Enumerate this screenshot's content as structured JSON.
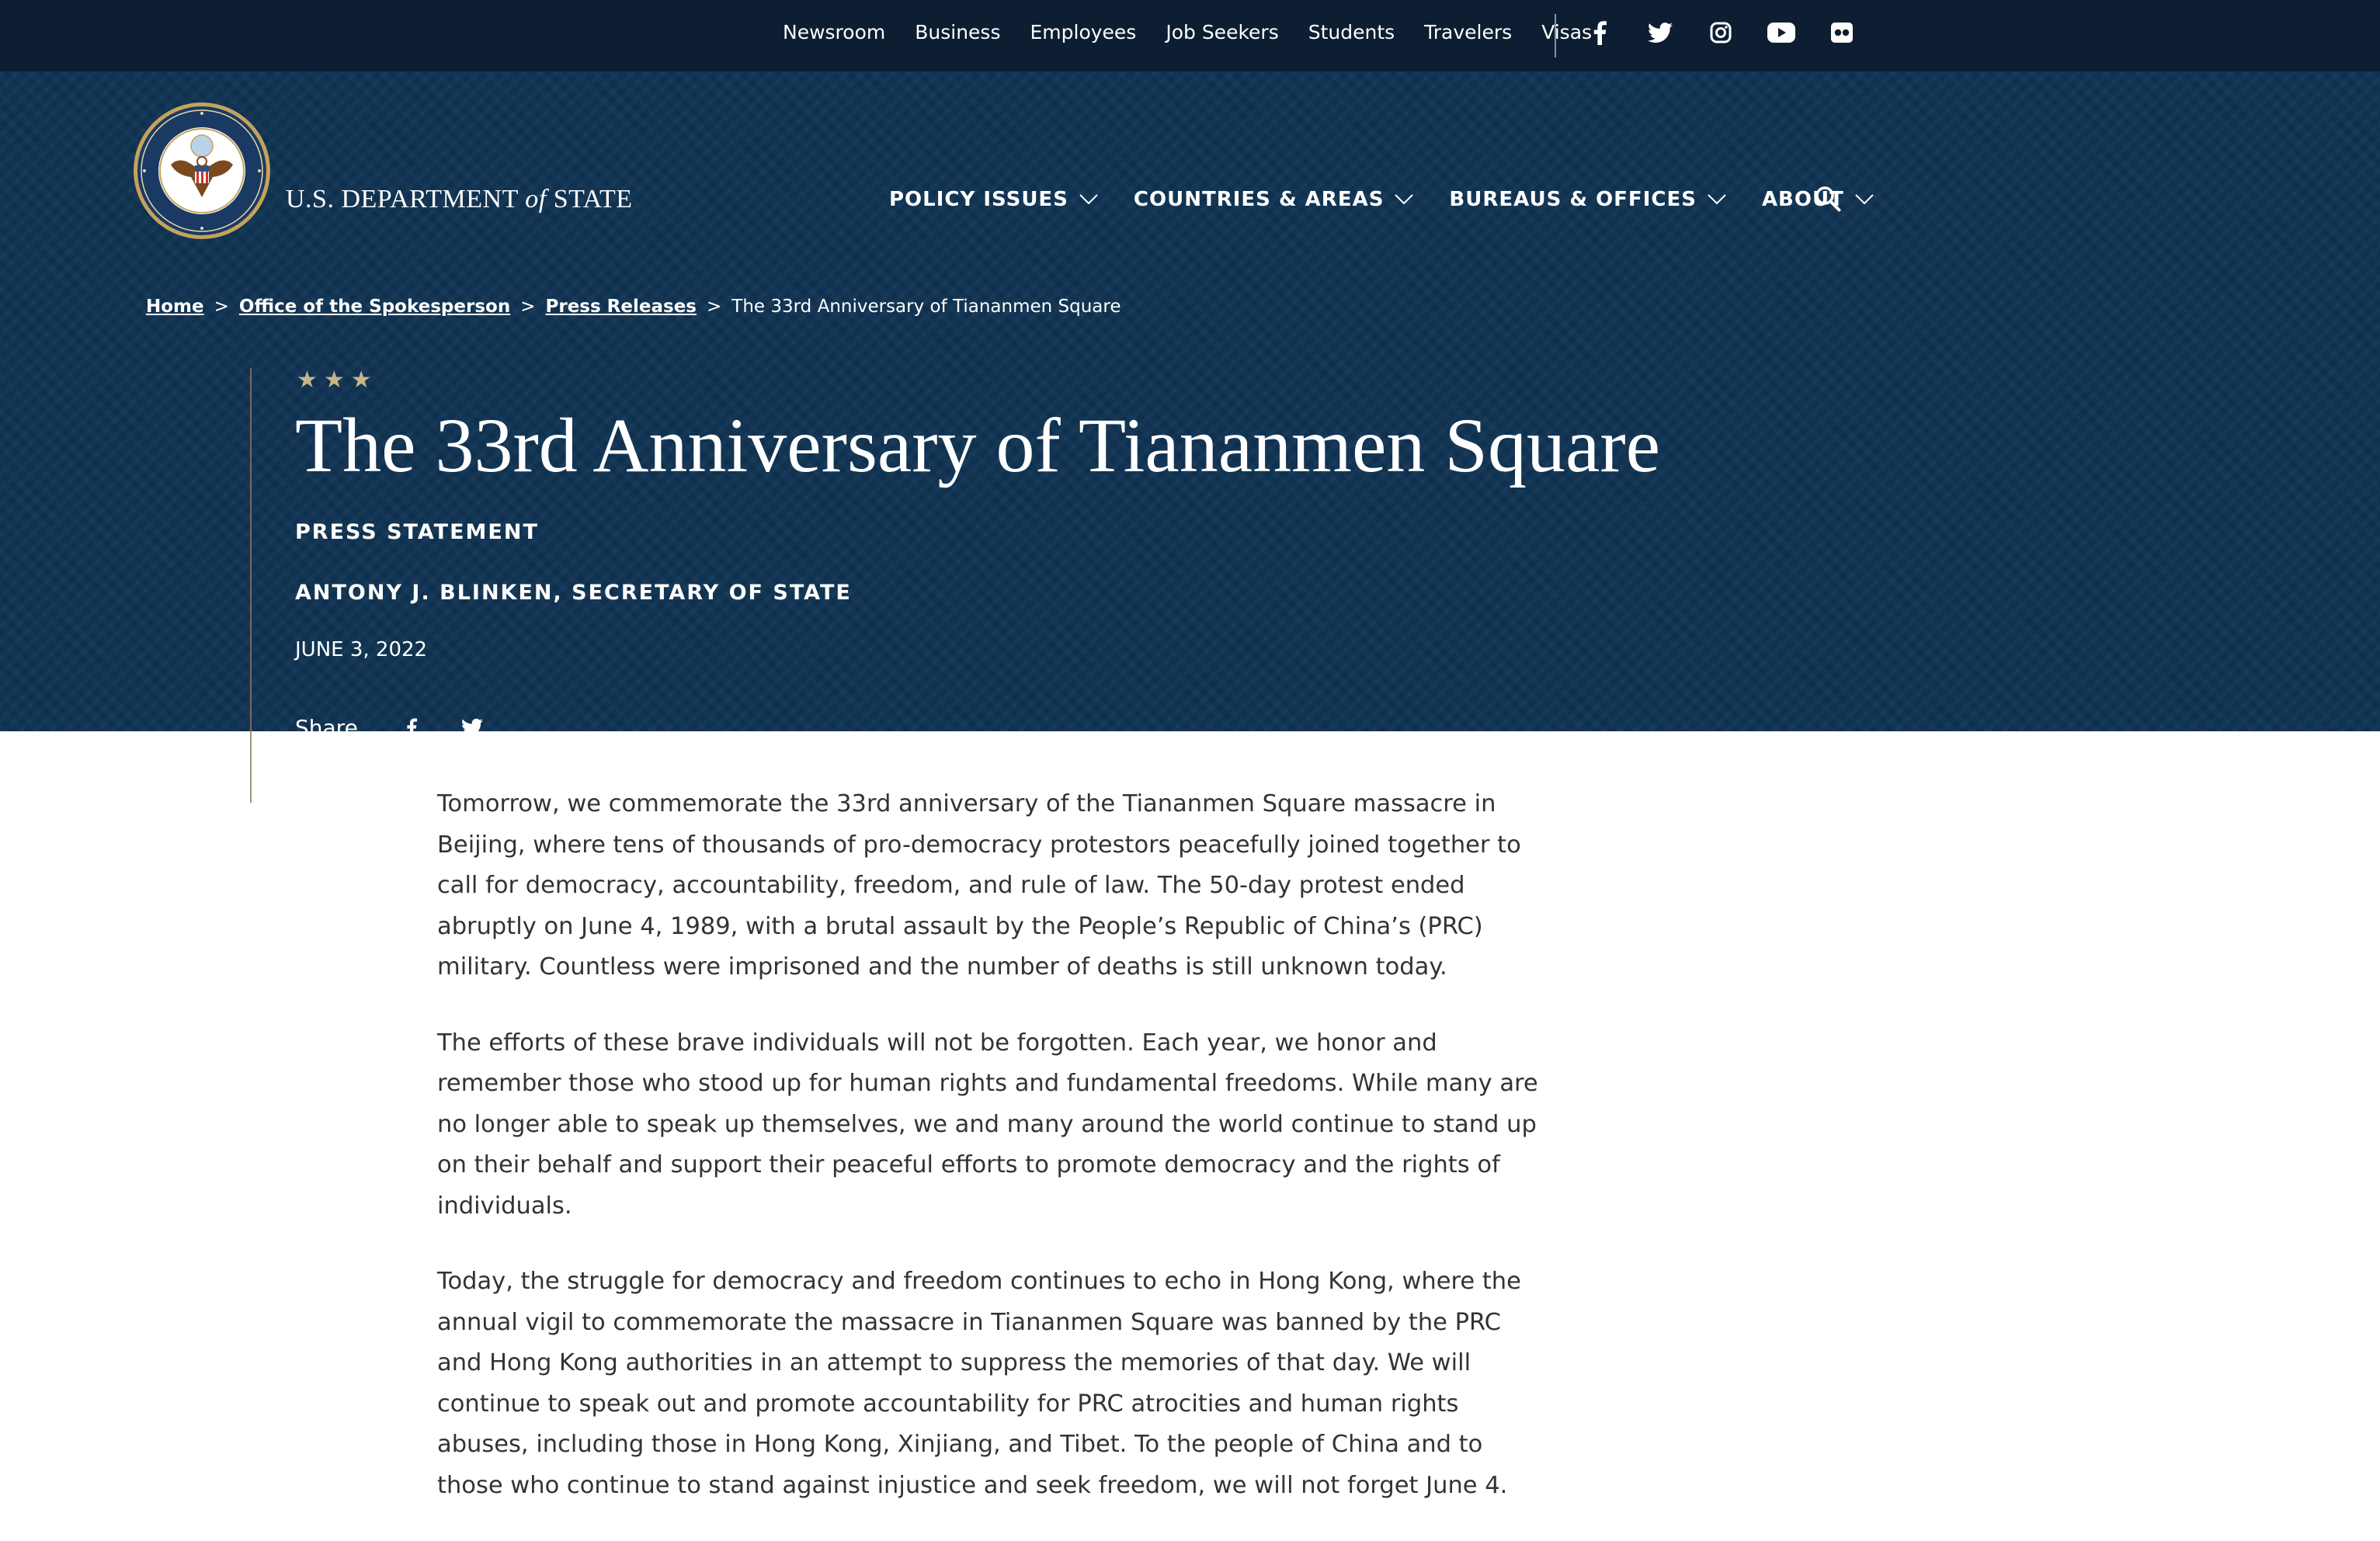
{
  "utility_nav": [
    "Newsroom",
    "Business",
    "Employees",
    "Job Seekers",
    "Students",
    "Travelers",
    "Visas"
  ],
  "social_icons": [
    "facebook-icon",
    "twitter-icon",
    "instagram-icon",
    "youtube-icon",
    "flickr-icon"
  ],
  "brand": {
    "part1": "U.S. DEPARTMENT ",
    "part2": "of",
    "part3": " STATE"
  },
  "main_nav": [
    "POLICY ISSUES",
    "COUNTRIES & AREAS",
    "BUREAUS & OFFICES",
    "ABOUT"
  ],
  "breadcrumb": {
    "home": "Home",
    "spokesperson": "Office of the Spokesperson",
    "press": "Press Releases",
    "sep": ">",
    "current": "The 33rd Anniversary of Tiananmen Square"
  },
  "article": {
    "stars": "★★★",
    "title": "The 33rd Anniversary of Tiananmen Square",
    "type": "PRESS STATEMENT",
    "author": "ANTONY J. BLINKEN, SECRETARY OF STATE",
    "date": "JUNE 3, 2022",
    "share_label": "Share",
    "paragraphs": [
      "Tomorrow, we commemorate the 33rd anniversary of the Tiananmen Square massacre in Beijing, where tens of thousands of pro-democracy protestors peacefully joined together to call for democracy, accountability, freedom, and rule of law.  The 50-day protest ended abruptly on June 4, 1989, with a brutal assault by the People’s Republic of China’s (PRC) military.  Countless were imprisoned and the number of deaths is still unknown today.",
      "The efforts of these brave individuals will not be forgotten.  Each year, we honor and remember those who stood up for human rights and fundamental freedoms.  While many are no longer able to speak up themselves, we and many around the world continue to stand up on their behalf and support their peaceful efforts to promote democracy and the rights of individuals.",
      "Today, the struggle for democracy and freedom continues to echo in Hong Kong, where the annual vigil to commemorate the massacre in Tiananmen Square was banned by the PRC and Hong Kong authorities in an attempt to suppress the memories of that day.  We will continue to speak out and promote accountability for PRC atrocities and human rights abuses, including those in Hong Kong, Xinjiang, and Tibet.  To the people of China and to those who continue to stand against injustice and seek freedom, we will not forget June 4."
    ]
  },
  "colors": {
    "topbar": "#0d1e33",
    "hero": "#0f3352",
    "star": "#c9b48c",
    "body_text": "#333333"
  }
}
